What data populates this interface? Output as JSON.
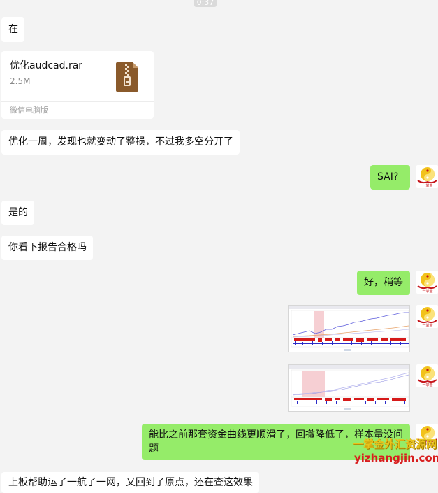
{
  "chat": {
    "timestamp": "0:37",
    "messages": [
      {
        "text": "在"
      },
      {
        "text": "优化一周，发现也就变动了整损，不过我多空分开了"
      },
      {
        "text": "SAI?"
      },
      {
        "text": "是的"
      },
      {
        "text": "你看下报告合格吗"
      },
      {
        "text": "好，稍等"
      },
      {
        "text_line1": "能比之前那套资金曲线更顺滑了，回撤降低了，样本量没问",
        "text_line2": "题"
      },
      {
        "text": "上板帮助运了一航了一网，又回到了原点，还在查这效果"
      }
    ],
    "file": {
      "name": "优化audcad.rar",
      "size": "2.5M",
      "source": "微信电脑版",
      "icon": "zip-file-icon"
    }
  },
  "watermark": {
    "cn": "一掌金外汇资源网",
    "url": "yizhangjin.com",
    "avatar_text": "一掌金"
  },
  "colors": {
    "outgoing_bubble": "#95ec69",
    "incoming_bubble": "#ffffff",
    "background": "#f3f3f3"
  }
}
